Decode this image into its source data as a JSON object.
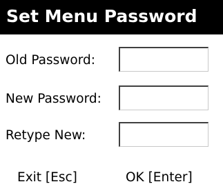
{
  "title": "Set Menu Password",
  "fields": [
    {
      "label": "Old Password:",
      "value": ""
    },
    {
      "label": "New Password:",
      "value": ""
    },
    {
      "label": "Retype New:",
      "value": ""
    }
  ],
  "softkeys": {
    "exit": "Exit [Esc]",
    "ok": "OK [Enter]"
  },
  "colors": {
    "title_bar_bg": "#000000",
    "title_text": "#ffffff",
    "background": "#ffffff"
  }
}
